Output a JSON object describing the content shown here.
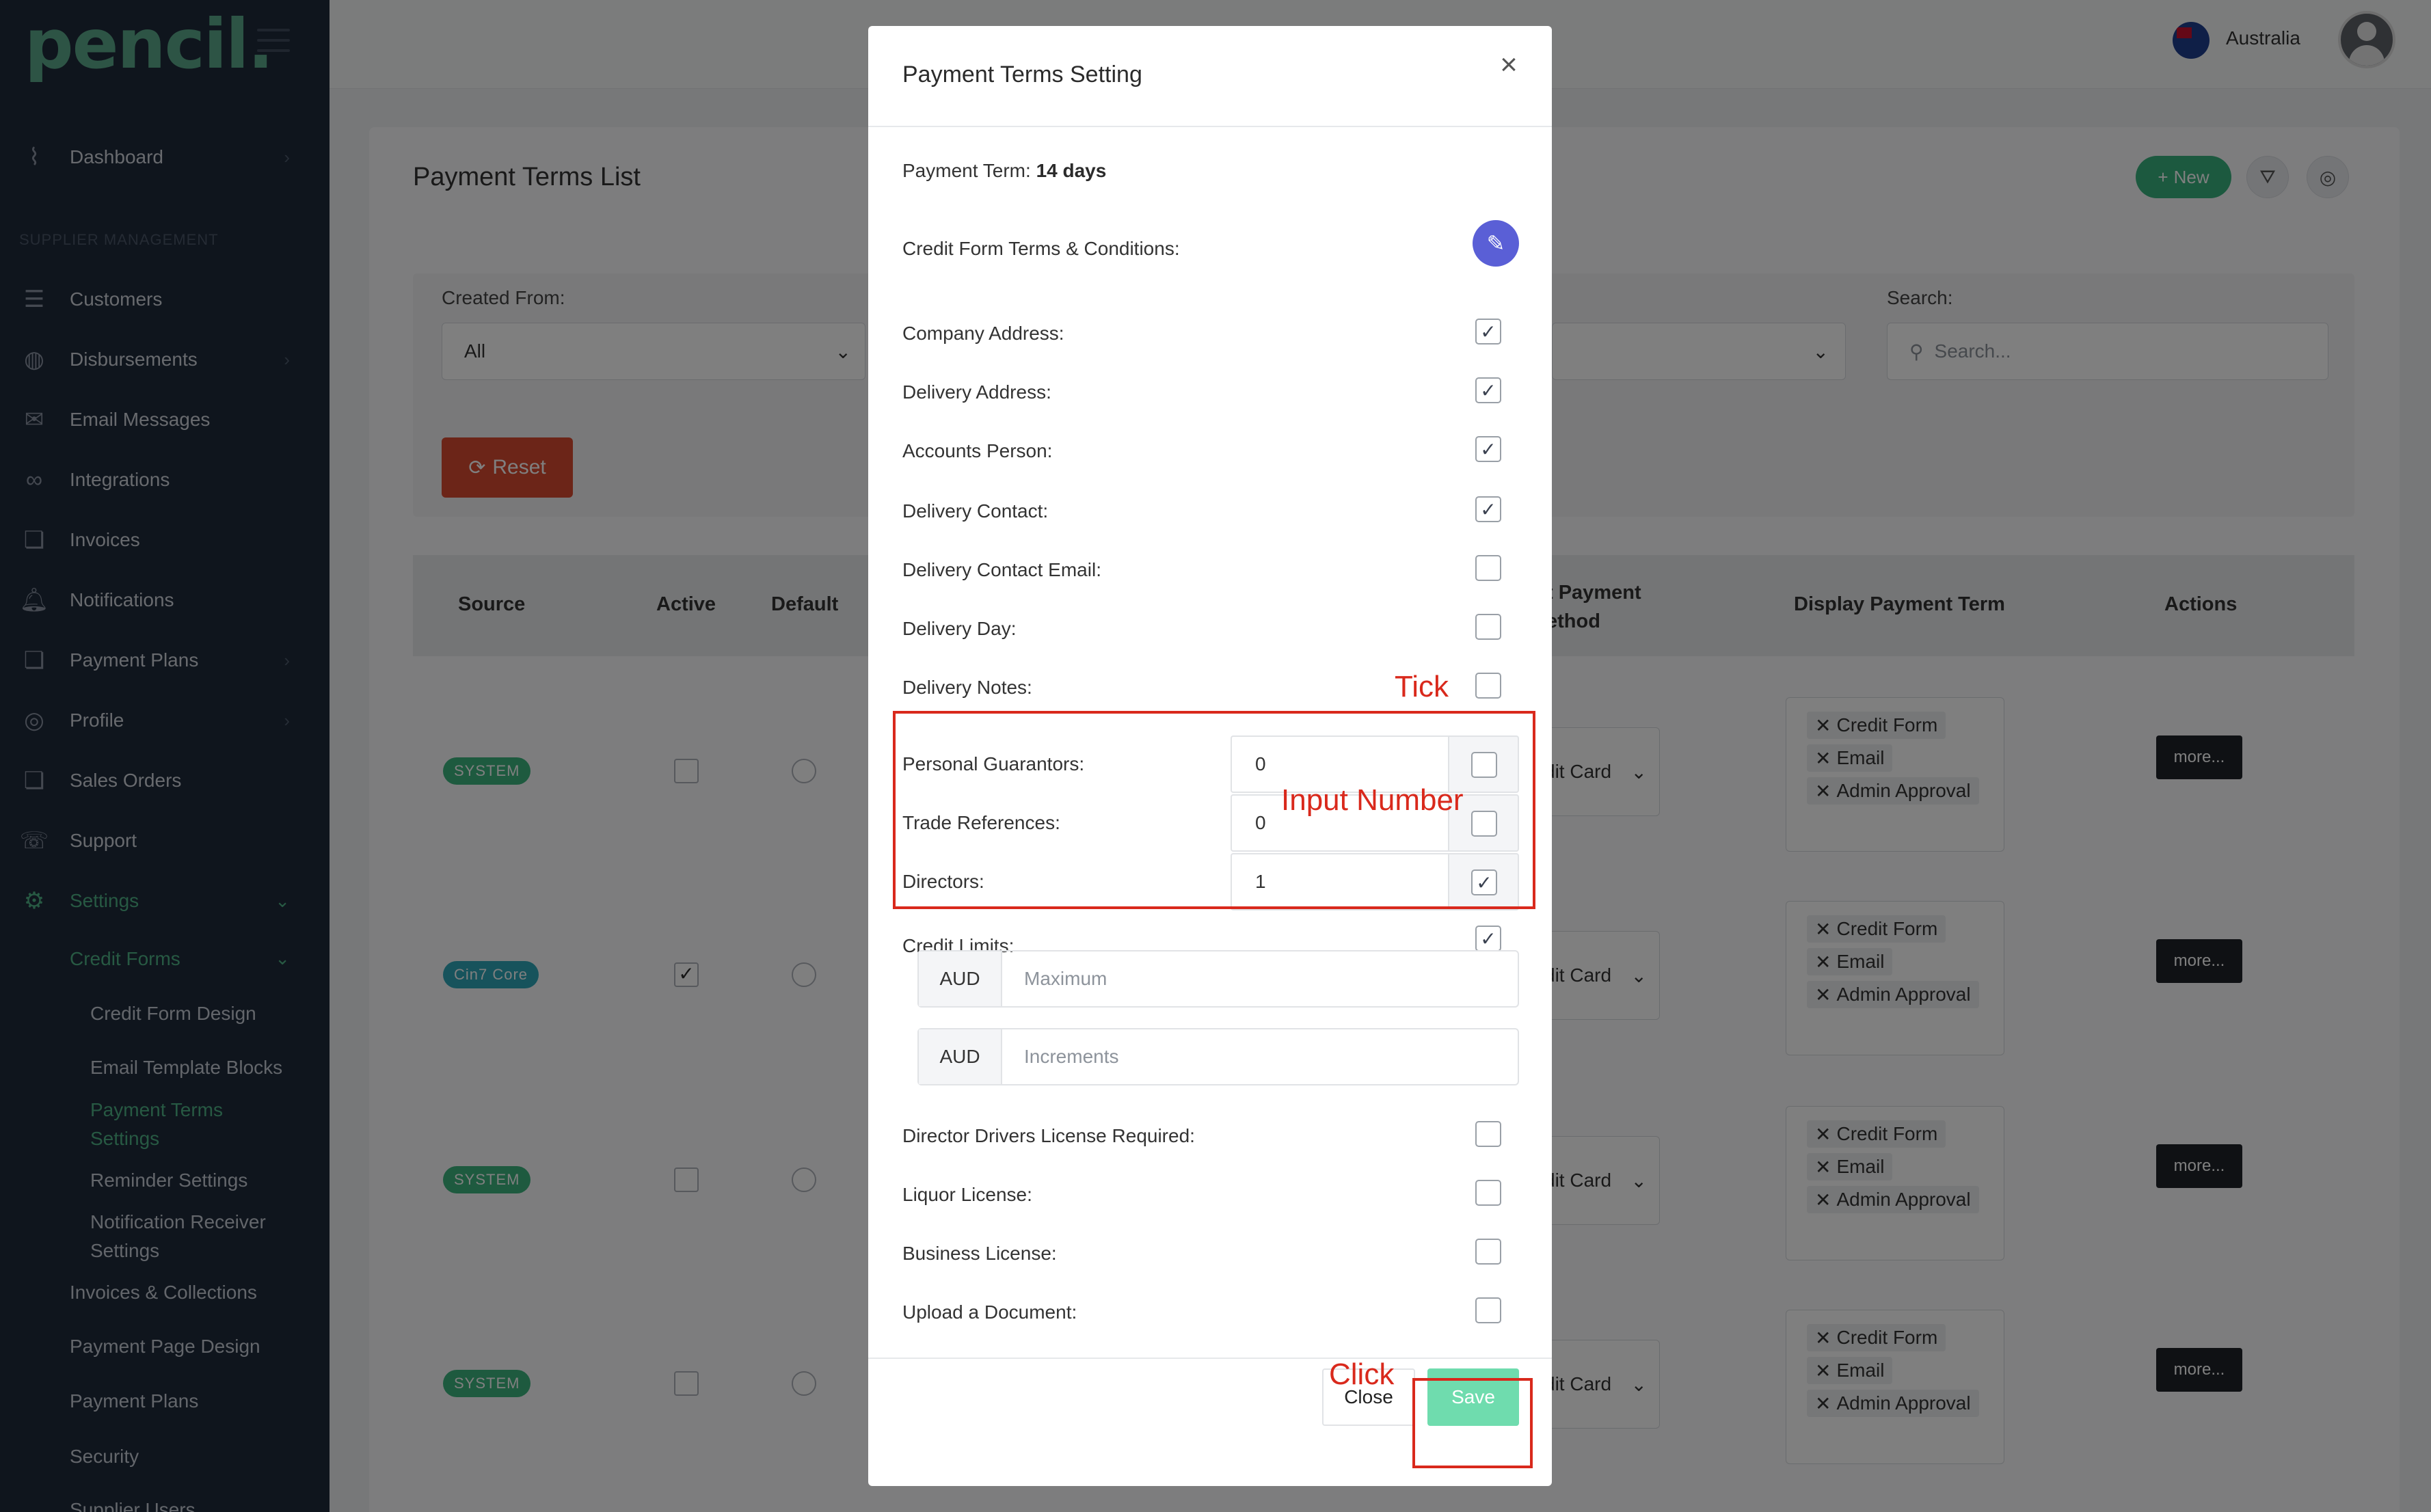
{
  "sidebar": {
    "logo": "pencil.",
    "section_label": "SUPPLIER MANAGEMENT",
    "items": [
      {
        "label": "Dashboard",
        "icon": "chart-icon",
        "chevron": true
      },
      {
        "label": "Customers",
        "icon": "list-icon",
        "chevron": false
      },
      {
        "label": "Disbursements",
        "icon": "coins-icon",
        "chevron": true
      },
      {
        "label": "Email Messages",
        "icon": "envelope-icon",
        "chevron": false
      },
      {
        "label": "Integrations",
        "icon": "infinity-icon",
        "chevron": false
      },
      {
        "label": "Invoices",
        "icon": "documents-icon",
        "chevron": false
      },
      {
        "label": "Notifications",
        "icon": "bell-icon",
        "chevron": false
      },
      {
        "label": "Payment Plans",
        "icon": "documents-icon",
        "chevron": true
      },
      {
        "label": "Profile",
        "icon": "globe-icon",
        "chevron": true
      },
      {
        "label": "Sales Orders",
        "icon": "documents-icon",
        "chevron": false
      },
      {
        "label": "Support",
        "icon": "phone-icon",
        "chevron": false
      },
      {
        "label": "Settings",
        "icon": "gear-icon",
        "chevron": true
      }
    ],
    "credit_forms": "Credit Forms",
    "sub_items": [
      "Credit Form Design",
      "Email Template Blocks",
      "Payment Terms Settings",
      "Reminder Settings",
      "Notification Receiver Settings"
    ],
    "lower_items": [
      "Invoices & Collections",
      "Payment Page Design",
      "Payment Plans",
      "Security",
      "Supplier Users"
    ]
  },
  "topbar": {
    "country": "Australia"
  },
  "page": {
    "title": "Payment Terms List",
    "new_label": "New",
    "filters": {
      "created_from_label": "Created From:",
      "created_from_value": "All",
      "search_label": "Search:",
      "search_placeholder": "Search..."
    },
    "reset_label": "Reset",
    "columns": {
      "source": "Source",
      "active": "Active",
      "default": "Default",
      "payment_method": "t Payment\nethod",
      "display_term": "Display Payment Term",
      "actions": "Actions"
    },
    "rows": [
      {
        "source": "SYSTEM",
        "color": "#3cb47f",
        "active": false,
        "payment": "dit Card"
      },
      {
        "source": "Cin7 Core",
        "color": "#2fa6b8",
        "active": true,
        "payment": "dit Card"
      },
      {
        "source": "SYSTEM",
        "color": "#3cb47f",
        "active": false,
        "payment": "dit Card"
      },
      {
        "source": "SYSTEM",
        "color": "#3cb47f",
        "active": false,
        "payment": "dit Card"
      }
    ],
    "term_tags": [
      "Credit Form",
      "Email",
      "Admin Approval"
    ],
    "more_label": "more..."
  },
  "modal": {
    "title": "Payment Terms Setting",
    "payment_term_label": "Payment Term:",
    "payment_term_value": "14 days",
    "credit_form_tc_label": "Credit Form Terms & Conditions:",
    "checks": [
      {
        "label": "Company Address:",
        "checked": true
      },
      {
        "label": "Delivery Address:",
        "checked": true
      },
      {
        "label": "Accounts Person:",
        "checked": true
      },
      {
        "label": "Delivery Contact:",
        "checked": true
      },
      {
        "label": "Delivery Contact Email:",
        "checked": false
      },
      {
        "label": "Delivery Day:",
        "checked": false
      },
      {
        "label": "Delivery Notes:",
        "checked": false
      }
    ],
    "number_rows": [
      {
        "label": "Personal Guarantors:",
        "value": "0",
        "checked": false
      },
      {
        "label": "Trade References:",
        "value": "0",
        "checked": false
      },
      {
        "label": "Directors:",
        "value": "1",
        "checked": true
      }
    ],
    "credit_limits_label": "Credit Limits:",
    "credit_limits_checked": true,
    "currency": "AUD",
    "maximum_placeholder": "Maximum",
    "increments_placeholder": "Increments",
    "bottom_checks": [
      {
        "label": "Director Drivers License Required:",
        "checked": false
      },
      {
        "label": "Liquor License:",
        "checked": false
      },
      {
        "label": "Business License:",
        "checked": false
      },
      {
        "label": "Upload a Document:",
        "checked": false
      }
    ],
    "close_label": "Close",
    "save_label": "Save"
  },
  "annotations": {
    "tick": "Tick",
    "input_number": "Input Number",
    "click": "Click",
    "color": "#d9291c"
  }
}
